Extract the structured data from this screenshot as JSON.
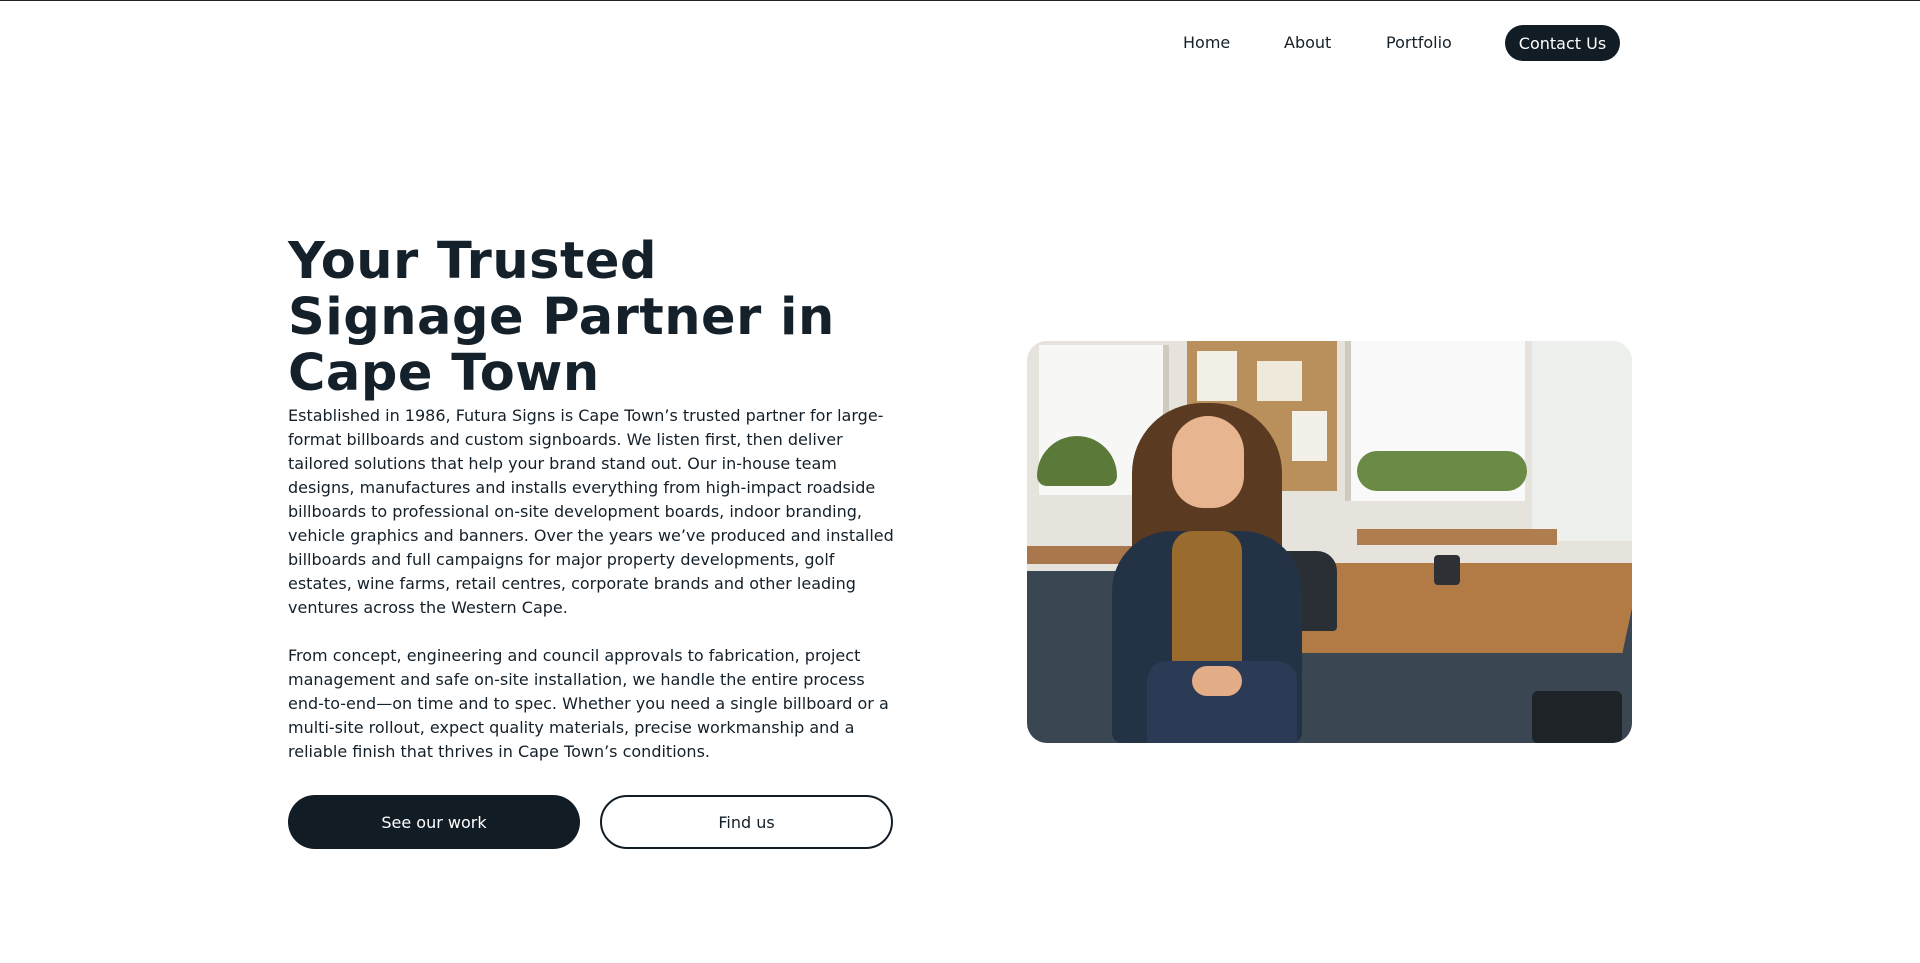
{
  "nav": {
    "links": [
      "Home",
      "About",
      "Portfolio"
    ],
    "cta_label": "Contact Us"
  },
  "hero": {
    "title": "Your Trusted Signage Partner in Cape Town",
    "paragraphs": [
      "Established in 1986, Futura Signs is Cape Town’s trusted partner for large-format billboards and custom signboards. We listen first, then deliver tailored solutions that help your brand stand out. Our in-house team designs, manufactures and installs everything from high-impact roadside billboards to professional on-site development boards, indoor branding, vehicle graphics and banners. Over the years we’ve produced and installed billboards and full campaigns for major property developments, golf estates, wine farms, retail centres, corporate brands and other leading ventures across the Western Cape.",
      "From concept, engineering and council approvals to fabrication, project management and safe on-site installation, we handle the entire process end-to-end—on time and to spec. Whether you need a single billboard or a multi-site rollout, expect quality materials, precise workmanship and a reliable finish that thrives in Cape Town’s conditions."
    ],
    "primary_button": "See our work",
    "secondary_button": "Find us"
  },
  "colors": {
    "accent": "#121c25",
    "text": "#14202a",
    "background": "#ffffff"
  }
}
